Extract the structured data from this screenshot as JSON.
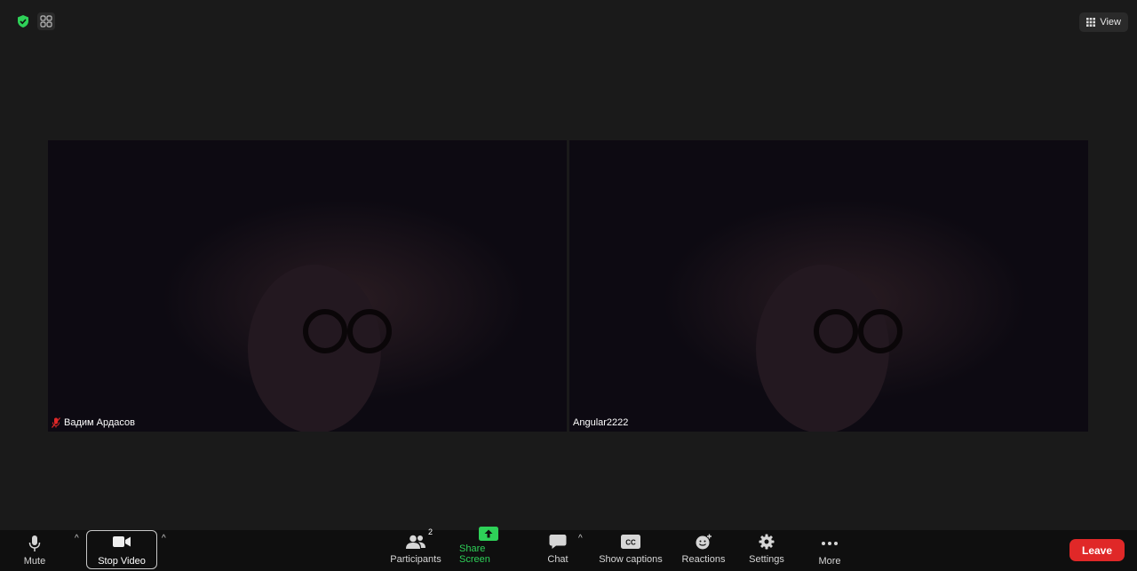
{
  "top": {
    "view_label": "View"
  },
  "tiles": [
    {
      "name": "Вадим Ардасов",
      "muted": true
    },
    {
      "name": "Angular2222",
      "muted": false
    }
  ],
  "toolbar": {
    "mute_label": "Mute",
    "stop_video_label": "Stop Video",
    "participants_label": "Participants",
    "participants_count": "2",
    "share_screen_label": "Share Screen",
    "chat_label": "Chat",
    "captions_label": "Show captions",
    "captions_icon_text": "CC",
    "reactions_label": "Reactions",
    "settings_label": "Settings",
    "more_label": "More",
    "leave_label": "Leave"
  },
  "colors": {
    "background": "#1a1a1a",
    "toolbar": "#0f0f0f",
    "security_green": "#2ed158",
    "share_green": "#2ed158",
    "leave_red": "#e02828"
  }
}
